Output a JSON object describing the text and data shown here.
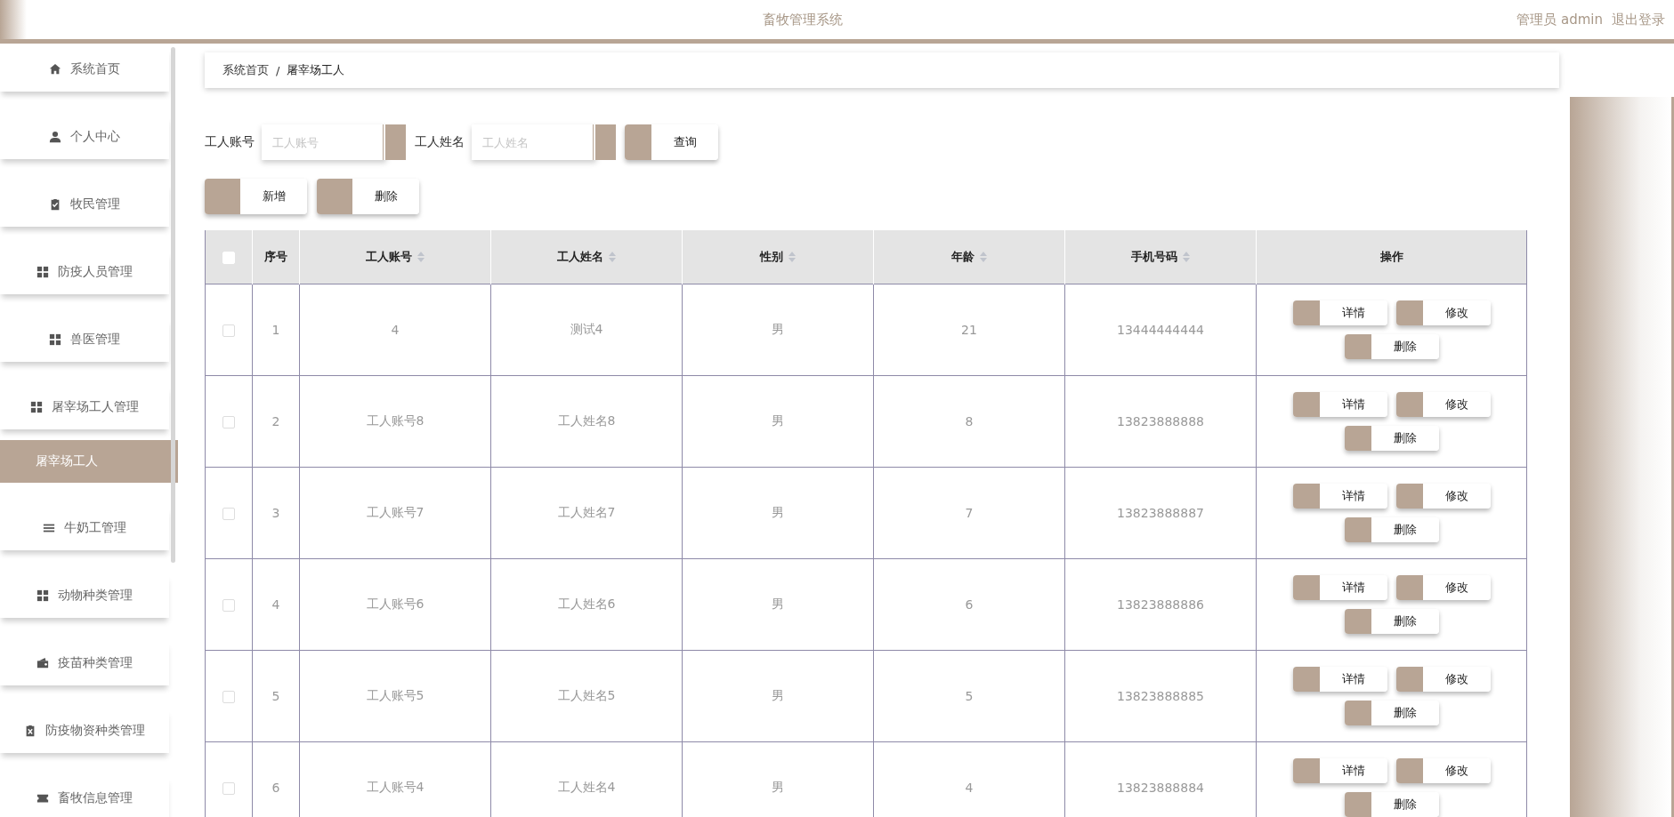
{
  "header": {
    "title": "畜牧管理系统",
    "user": "管理员 admin",
    "logout": "退出登录"
  },
  "sidebar": {
    "items": [
      {
        "label": "系统首页",
        "selected": false
      },
      {
        "label": "个人中心",
        "selected": false
      },
      {
        "label": "牧民管理",
        "selected": false
      },
      {
        "label": "防疫人员管理",
        "selected": false
      },
      {
        "label": "兽医管理",
        "selected": false
      },
      {
        "label": "屠宰场工人管理",
        "selected": false,
        "expanded": true,
        "children": [
          {
            "label": "屠宰场工人",
            "selected": true
          }
        ]
      },
      {
        "label": "牛奶工管理",
        "selected": false
      },
      {
        "label": "动物种类管理",
        "selected": false
      },
      {
        "label": "疫苗种类管理",
        "selected": false
      },
      {
        "label": "防疫物资种类管理",
        "selected": false
      },
      {
        "label": "畜牧信息管理",
        "selected": false
      }
    ]
  },
  "breadcrumb": [
    "系统首页",
    "/",
    "屠宰场工人"
  ],
  "search": {
    "fields": [
      {
        "label": "工人账号",
        "placeholder": "工人账号"
      },
      {
        "label": "工人姓名",
        "placeholder": "工人姓名"
      }
    ],
    "button": "查询"
  },
  "actions": [
    "新增",
    "删除"
  ],
  "table": {
    "columns": [
      {
        "label": "序号",
        "sortable": false
      },
      {
        "label": "工人账号",
        "sortable": true
      },
      {
        "label": "工人姓名",
        "sortable": true
      },
      {
        "label": "性别",
        "sortable": true
      },
      {
        "label": "年龄",
        "sortable": true
      },
      {
        "label": "手机号码",
        "sortable": true
      },
      {
        "label": "操作",
        "sortable": false
      }
    ],
    "header_checked": false,
    "rows": [
      {
        "checked": false,
        "cells": [
          "1",
          "4",
          "测试4",
          "男",
          "21",
          "13444444444"
        ],
        "buttons": [
          "详情",
          "修改",
          "删除"
        ]
      },
      {
        "checked": false,
        "cells": [
          "2",
          "工人账号8",
          "工人姓名8",
          "男",
          "8",
          "13823888888"
        ],
        "buttons": [
          "详情",
          "修改",
          "删除"
        ]
      },
      {
        "checked": false,
        "cells": [
          "3",
          "工人账号7",
          "工人姓名7",
          "男",
          "7",
          "13823888887"
        ],
        "buttons": [
          "详情",
          "修改",
          "删除"
        ]
      },
      {
        "checked": false,
        "cells": [
          "4",
          "工人账号6",
          "工人姓名6",
          "男",
          "6",
          "13823888886"
        ],
        "buttons": [
          "详情",
          "修改",
          "删除"
        ]
      },
      {
        "checked": false,
        "cells": [
          "5",
          "工人账号5",
          "工人姓名5",
          "男",
          "5",
          "13823888885"
        ],
        "buttons": [
          "详情",
          "修改",
          "删除"
        ]
      },
      {
        "checked": false,
        "cells": [
          "6",
          "工人账号4",
          "工人姓名4",
          "男",
          "4",
          "13823888884"
        ],
        "buttons": [
          "详情",
          "修改",
          "删除"
        ]
      }
    ]
  }
}
